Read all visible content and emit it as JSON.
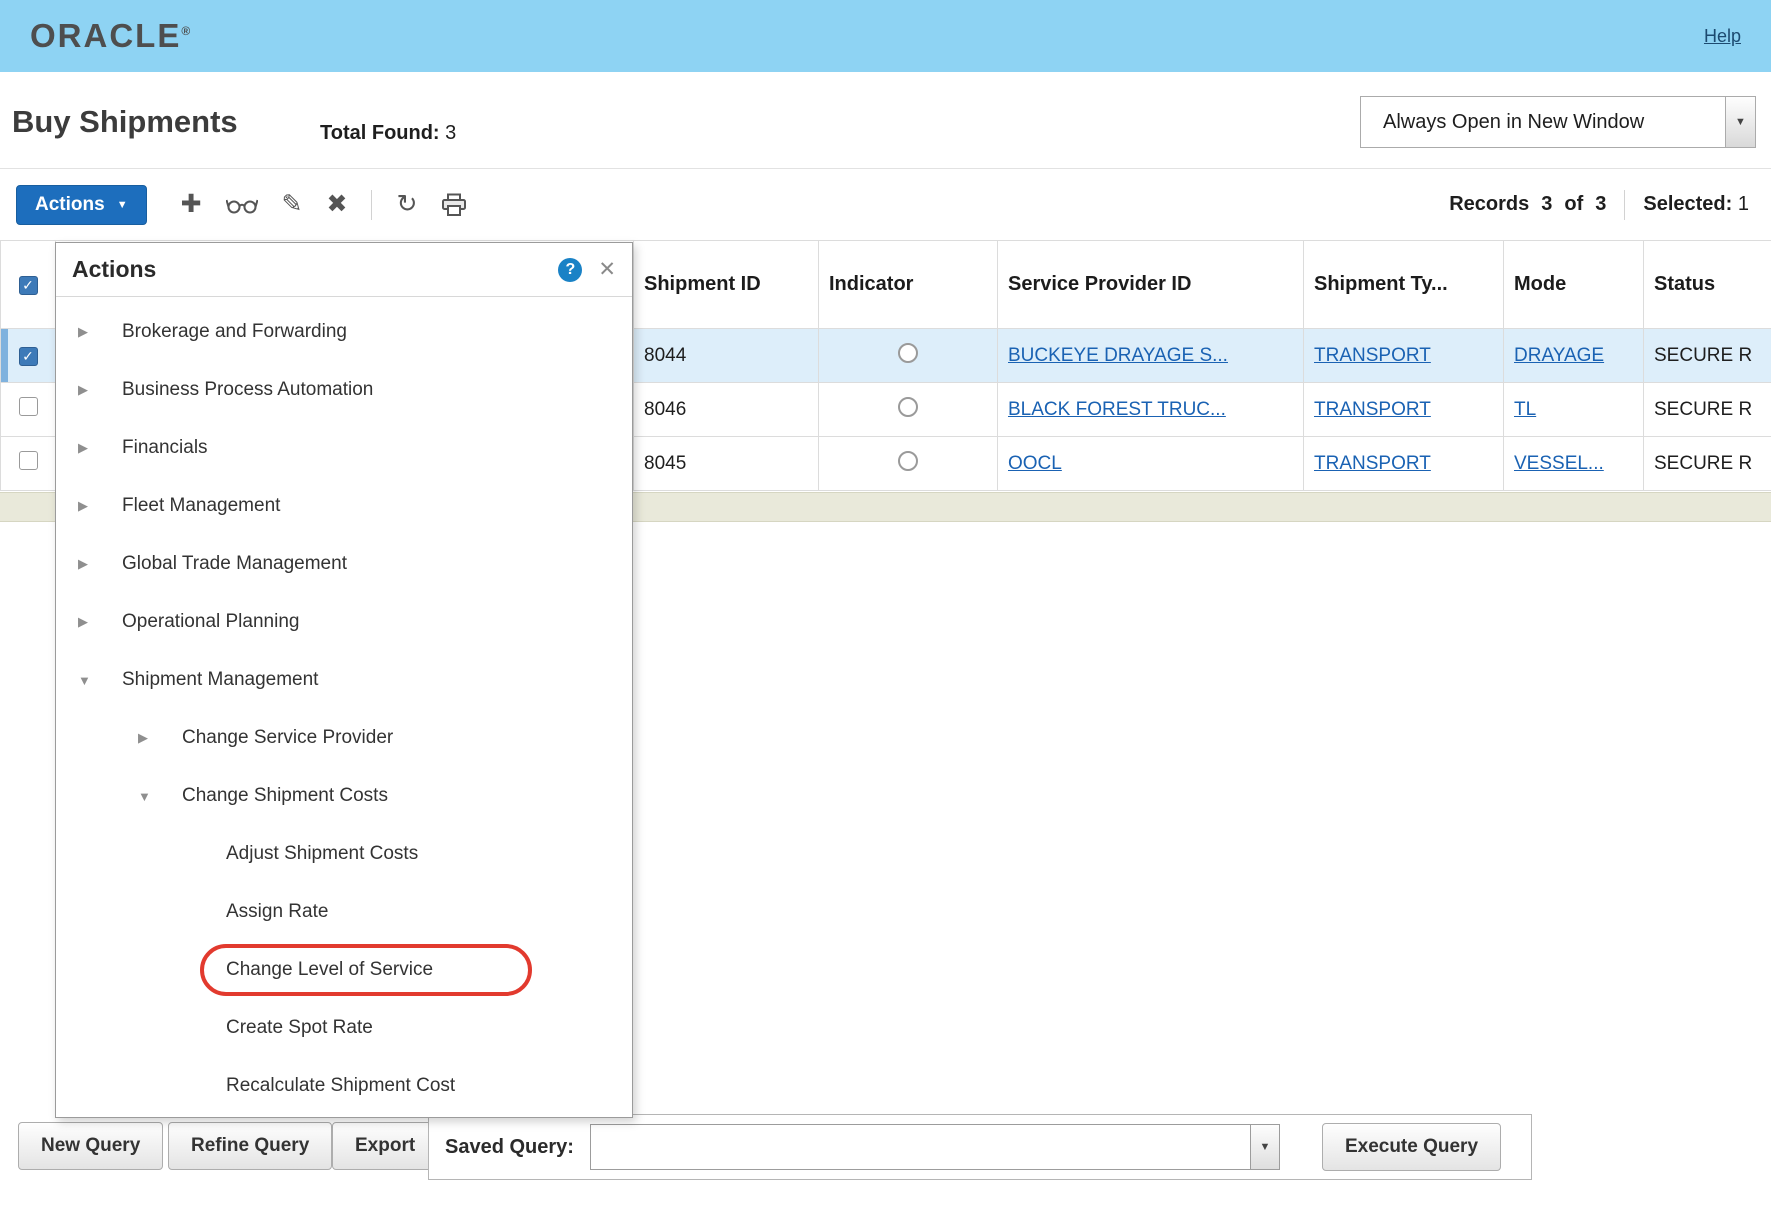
{
  "colors": {
    "topbar_bg": "#8ed3f3",
    "accent_blue": "#1d6ebd",
    "link_blue": "#1a62b3",
    "selected_row_bg": "#ddeefa",
    "highlight_red": "#e23a2e",
    "beige_strip": "#e9e9da"
  },
  "topbar": {
    "logo_text": "ORACLE",
    "registered_mark": "®",
    "help_link": "Help"
  },
  "page": {
    "title": "Buy Shipments",
    "total_found_label": "Total Found:",
    "total_found_value": "3",
    "open_mode_value": "Always Open in New Window"
  },
  "toolbar": {
    "actions_button_label": "Actions",
    "records_label": "Records",
    "records_shown": "3",
    "records_of_label": "of",
    "records_total": "3",
    "selected_label": "Selected:",
    "selected_value": "1"
  },
  "table": {
    "columns": {
      "shipment_id": "Shipment ID",
      "indicator": "Indicator",
      "service_provider_id": "Service Provider ID",
      "shipment_type": "Shipment Ty...",
      "mode": "Mode",
      "status": "Status"
    },
    "rows": [
      {
        "shipment_id": "8044",
        "service_provider_id": "BUCKEYE DRAYAGE S...",
        "shipment_type": "TRANSPORT",
        "mode": "DRAYAGE",
        "status": "SECURE R",
        "selected": true
      },
      {
        "shipment_id": "8046",
        "service_provider_id": "BLACK FOREST TRUC...",
        "shipment_type": "TRANSPORT",
        "mode": "TL",
        "status": "SECURE R",
        "selected": false
      },
      {
        "shipment_id": "8045",
        "service_provider_id": "OOCL",
        "shipment_type": "TRANSPORT",
        "mode": "VESSEL...",
        "status": "SECURE R",
        "selected": false
      }
    ]
  },
  "actions_menu": {
    "title": "Actions",
    "items": [
      {
        "label": "Brokerage and Forwarding",
        "level": 1,
        "state": "collapsed"
      },
      {
        "label": "Business Process Automation",
        "level": 1,
        "state": "collapsed"
      },
      {
        "label": "Financials",
        "level": 1,
        "state": "collapsed"
      },
      {
        "label": "Fleet Management",
        "level": 1,
        "state": "collapsed"
      },
      {
        "label": "Global Trade Management",
        "level": 1,
        "state": "collapsed"
      },
      {
        "label": "Operational Planning",
        "level": 1,
        "state": "collapsed"
      },
      {
        "label": "Shipment Management",
        "level": 1,
        "state": "expanded"
      },
      {
        "label": "Change Service Provider",
        "level": 2,
        "state": "collapsed"
      },
      {
        "label": "Change Shipment Costs",
        "level": 2,
        "state": "expanded"
      },
      {
        "label": "Adjust Shipment Costs",
        "level": 3,
        "state": "leaf"
      },
      {
        "label": "Assign Rate",
        "level": 3,
        "state": "leaf"
      },
      {
        "label": "Change Level of Service",
        "level": 3,
        "state": "leaf",
        "highlighted": true
      },
      {
        "label": "Create Spot Rate",
        "level": 3,
        "state": "leaf"
      },
      {
        "label": "Recalculate Shipment Cost",
        "level": 3,
        "state": "leaf"
      }
    ]
  },
  "footer": {
    "new_query_label": "New Query",
    "refine_query_label": "Refine Query",
    "export_label": "Export",
    "saved_query_label": "Saved Query:",
    "saved_query_value": "",
    "execute_query_label": "Execute Query"
  },
  "icons": {
    "dropdown_arrow": "▼",
    "add": "✚",
    "edit": "✎",
    "delete": "✖",
    "refresh": "↻",
    "collapsed_arrow": "▶",
    "expanded_arrow": "▼",
    "help_badge": "?",
    "close": "✕",
    "check": "✓"
  }
}
